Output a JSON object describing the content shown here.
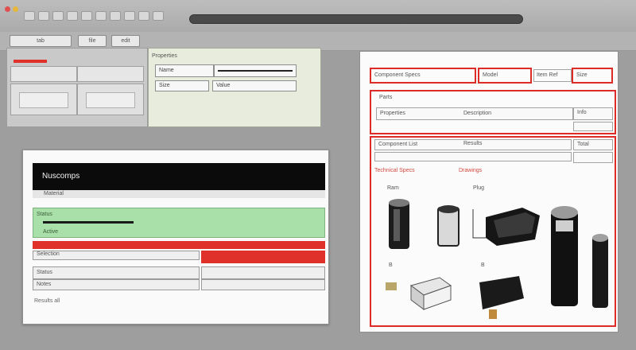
{
  "menubar": {
    "buttons": [
      "tab",
      "file",
      "edit"
    ]
  },
  "left_pane": {
    "header_title": "Properties",
    "field_label": "Name",
    "field_sub_label": "Size",
    "field_sub_value": "Value"
  },
  "dialog": {
    "title": "Nuscomps",
    "subtitle": "Material",
    "green_row_label": "Status",
    "green_row_sub": "Active",
    "rows": [
      "Selection",
      "Status",
      "Notes"
    ],
    "footer": "Results all"
  },
  "right_panel": {
    "tab_main": "Component Specs",
    "tab_item": "Model",
    "tab_alt": "Item Ref",
    "tab_last": "Size",
    "section_title": "Parts",
    "row_a_label": "Properties",
    "row_a_value": "Description",
    "row_a_extra": "Info",
    "row_b_label": "Component List",
    "row_b_value": "Results",
    "row_b_extra": "Total",
    "row_c_label": "Technical Specs",
    "row_c_value": "Drawings",
    "item_label_1": "Ram",
    "item_label_2": "Plug",
    "item_label_3": "B",
    "item_label_4": "B",
    "colors": {
      "accent": "#dd2b27",
      "green": "#a9dfa8"
    }
  }
}
